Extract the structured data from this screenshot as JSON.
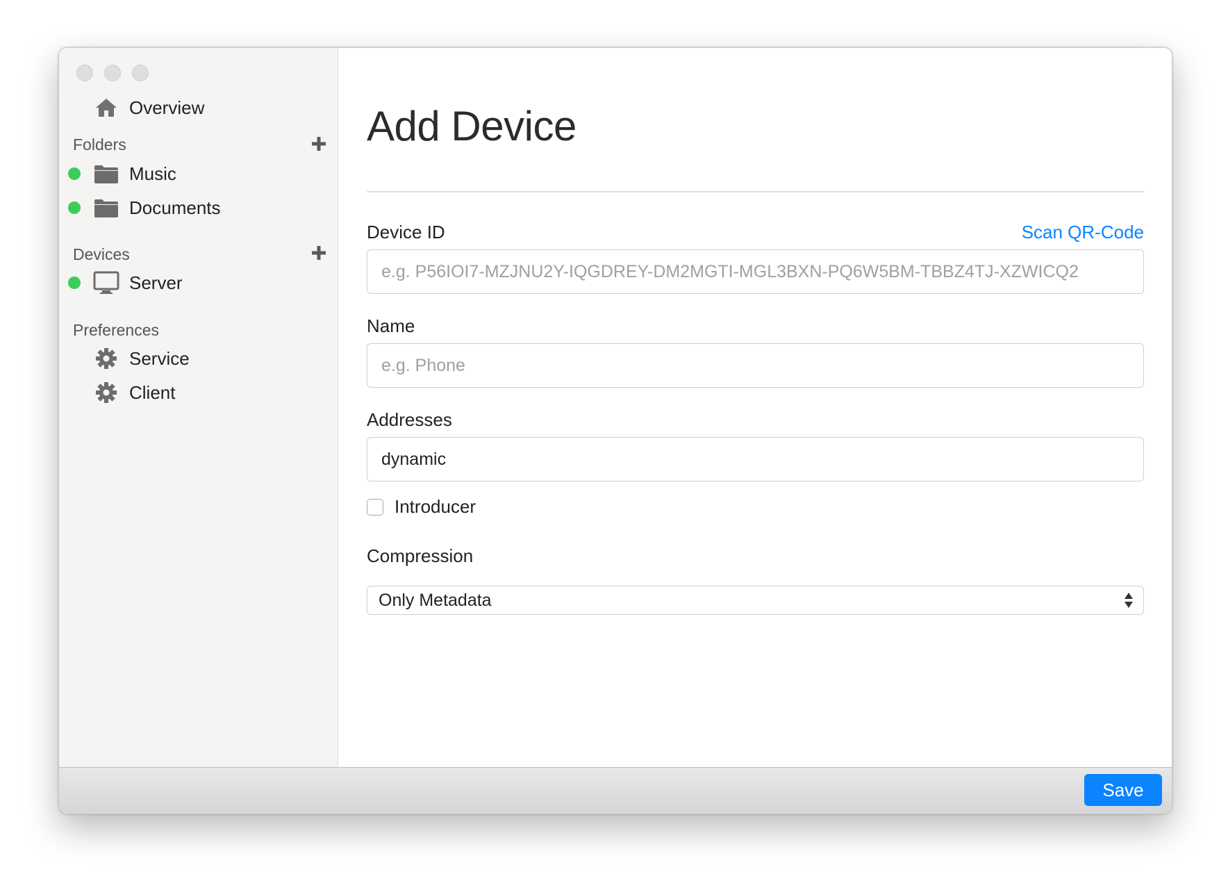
{
  "sidebar": {
    "overview": {
      "label": "Overview",
      "icon": "house-icon"
    },
    "folders": {
      "title": "Folders",
      "items": [
        {
          "label": "Music",
          "icon": "folder-icon",
          "status_color": "#3dcc5a"
        },
        {
          "label": "Documents",
          "icon": "folder-icon",
          "status_color": "#3dcc5a"
        }
      ]
    },
    "devices": {
      "title": "Devices",
      "items": [
        {
          "label": "Server",
          "icon": "monitor-icon",
          "status_color": "#3dcc5a"
        }
      ]
    },
    "preferences": {
      "title": "Preferences",
      "items": [
        {
          "label": "Service",
          "icon": "gear-icon"
        },
        {
          "label": "Client",
          "icon": "gear-icon"
        }
      ]
    }
  },
  "main": {
    "title": "Add Device",
    "device_id": {
      "label": "Device ID",
      "placeholder": "e.g. P56IOI7-MZJNU2Y-IQGDREY-DM2MGTI-MGL3BXN-PQ6W5BM-TBBZ4TJ-XZWICQ2",
      "scan_link": "Scan QR-Code"
    },
    "name": {
      "label": "Name",
      "placeholder": "e.g. Phone"
    },
    "addresses": {
      "label": "Addresses",
      "value": "dynamic"
    },
    "introducer": {
      "label": "Introducer",
      "checked": false
    },
    "compression": {
      "label": "Compression",
      "value": "Only Metadata"
    }
  },
  "footer": {
    "save_label": "Save"
  },
  "colors": {
    "accent": "#0a84ff",
    "status_online": "#3dcc5a"
  }
}
